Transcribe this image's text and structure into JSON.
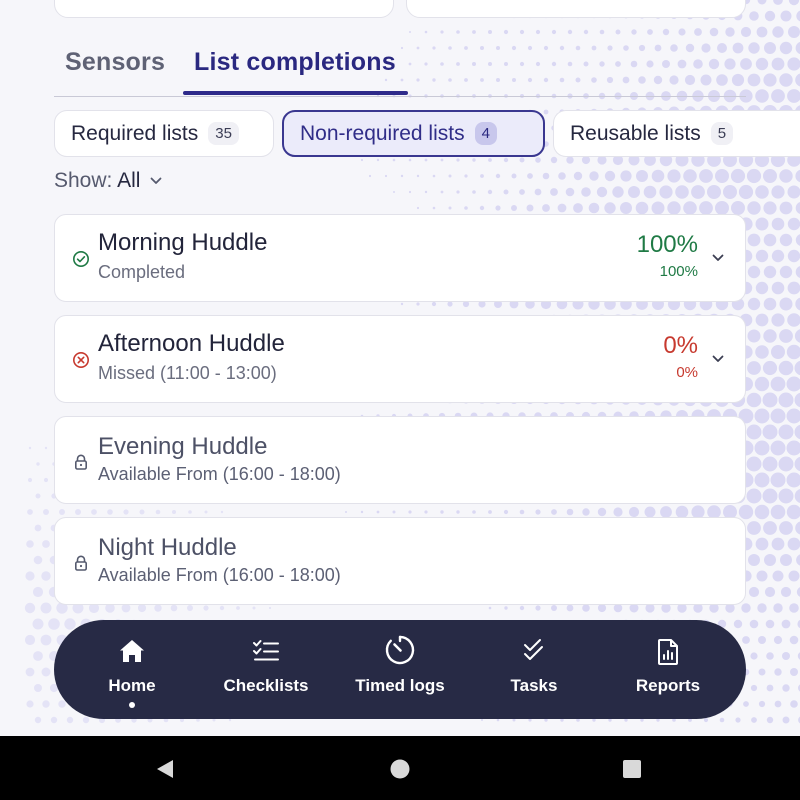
{
  "tabs": [
    {
      "label": "Sensors"
    },
    {
      "label": "List completions"
    }
  ],
  "active_tab": "List completions",
  "filters": [
    {
      "label": "Required lists",
      "count": "35"
    },
    {
      "label": "Non-required lists",
      "count": "4"
    },
    {
      "label": "Reusable lists",
      "count": "5"
    }
  ],
  "active_filter": "Non-required lists",
  "show": {
    "label": "Show:",
    "value": "All"
  },
  "lists": [
    {
      "title": "Morning Huddle",
      "status": "Completed",
      "percent": "100%",
      "percent_small": "100%",
      "state": "completed",
      "icon": "check-circle-icon"
    },
    {
      "title": "Afternoon Huddle",
      "status": "Missed (11:00 - 13:00)",
      "percent": "0%",
      "percent_small": "0%",
      "state": "missed",
      "icon": "x-circle-icon"
    },
    {
      "title": "Evening Huddle",
      "status": "Available From (16:00 - 18:00)",
      "state": "locked",
      "icon": "lock-icon"
    },
    {
      "title": "Night Huddle",
      "status": "Available From (16:00 - 18:00)",
      "state": "locked",
      "icon": "lock-icon"
    }
  ],
  "nav": [
    {
      "label": "Home",
      "icon": "home-icon",
      "active": true
    },
    {
      "label": "Checklists",
      "icon": "checklist-icon"
    },
    {
      "label": "Timed logs",
      "icon": "timer-icon"
    },
    {
      "label": "Tasks",
      "icon": "double-check-icon"
    },
    {
      "label": "Reports",
      "icon": "report-icon"
    }
  ],
  "colors": {
    "accent": "#2e2a8a",
    "nav_bg": "#272a45",
    "success": "#1f7a45",
    "danger": "#c73a2f",
    "background": "#f6f6fa"
  }
}
